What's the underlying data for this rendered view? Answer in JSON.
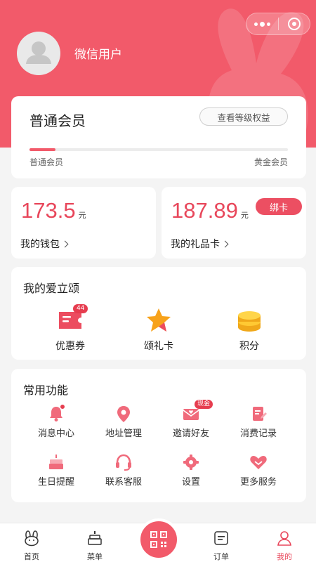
{
  "header": {
    "username": "微信用户"
  },
  "member": {
    "level_title": "普通会员",
    "rights_button": "查看等级权益",
    "progress_fraction": 0.1,
    "level_start": "普通会员",
    "level_end": "黄金会员"
  },
  "wallet": {
    "amount": "173.5",
    "unit": "元",
    "label": "我的钱包"
  },
  "gift_card": {
    "amount": "187.89",
    "unit": "元",
    "label": "我的礼品卡",
    "bind_button": "绑卡"
  },
  "mine": {
    "title": "我的爱立颂",
    "items": [
      {
        "label": "优惠券",
        "icon": "coupon-icon",
        "badge": "44"
      },
      {
        "label": "颂礼卡",
        "icon": "star-icon"
      },
      {
        "label": "积分",
        "icon": "coins-icon"
      }
    ]
  },
  "functions": {
    "title": "常用功能",
    "items": [
      {
        "label": "消息中心",
        "icon": "bell-icon"
      },
      {
        "label": "地址管理",
        "icon": "location-icon"
      },
      {
        "label": "邀请好友",
        "icon": "envelope-icon",
        "badge": "现金"
      },
      {
        "label": "消费记录",
        "icon": "receipt-icon"
      },
      {
        "label": "生日提醒",
        "icon": "cake-icon"
      },
      {
        "label": "联系客服",
        "icon": "headset-icon"
      },
      {
        "label": "设置",
        "icon": "gear-icon"
      },
      {
        "label": "更多服务",
        "icon": "heart-icon"
      }
    ]
  },
  "tabbar": {
    "tabs": [
      {
        "label": "首页",
        "icon": "bunny-icon"
      },
      {
        "label": "菜单",
        "icon": "cake-menu-icon"
      },
      {
        "label": "订单",
        "icon": "order-icon"
      },
      {
        "label": "我的",
        "icon": "person-icon",
        "active": true
      }
    ],
    "center_icon": "qr-code-icon"
  },
  "colors": {
    "brand": "#f25a6a",
    "accent_text": "#e8475b",
    "badge": "#e63d4f",
    "background": "#f4f4f4"
  }
}
